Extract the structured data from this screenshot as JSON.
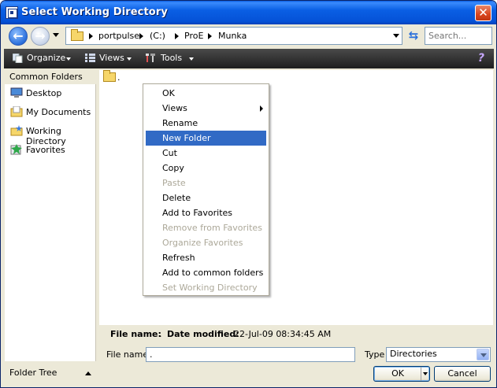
{
  "window": {
    "title": "Select Working Directory"
  },
  "address": {
    "crumbs": [
      "portpulse",
      "(C:)",
      "ProE",
      "Munka"
    ]
  },
  "search": {
    "placeholder": "Search..."
  },
  "commands": {
    "organize": "Organize",
    "views": "Views",
    "tools": "Tools"
  },
  "left_panel": {
    "header": "Common Folders",
    "items": [
      "Desktop",
      "My Documents",
      "Working Directory",
      "Favorites"
    ],
    "footer": "Folder Tree"
  },
  "files": [
    {
      "name": "."
    }
  ],
  "context_menu": {
    "items": [
      {
        "label": "OK",
        "enabled": true
      },
      {
        "label": "Views",
        "enabled": true,
        "submenu": true
      },
      {
        "label": "Rename",
        "enabled": true
      },
      {
        "label": "New Folder",
        "enabled": true,
        "highlighted": true
      },
      {
        "label": "Cut",
        "enabled": true
      },
      {
        "label": "Copy",
        "enabled": true
      },
      {
        "label": "Paste",
        "enabled": false
      },
      {
        "label": "Delete",
        "enabled": true
      },
      {
        "label": "Add to Favorites",
        "enabled": true
      },
      {
        "label": "Remove from Favorites",
        "enabled": false
      },
      {
        "label": "Organize Favorites",
        "enabled": false
      },
      {
        "label": "Refresh",
        "enabled": true
      },
      {
        "label": "Add to common folders",
        "enabled": true
      },
      {
        "label": "Set Working Directory",
        "enabled": false
      }
    ]
  },
  "info_bar": {
    "file_name_label": "File name:",
    "file_name_value": ".",
    "date_modified_label": "Date modified:",
    "date_modified_value": "22-Jul-09 08:34:45 AM"
  },
  "bottom": {
    "file_name_label": "File name:",
    "file_name_value": ".",
    "type_label": "Type",
    "type_value": "Directories",
    "ok_label": "OK",
    "cancel_label": "Cancel"
  },
  "colors": {
    "title_blue": "#0a5fe4",
    "highlight": "#316ac5",
    "disabled_text": "#aca899"
  }
}
